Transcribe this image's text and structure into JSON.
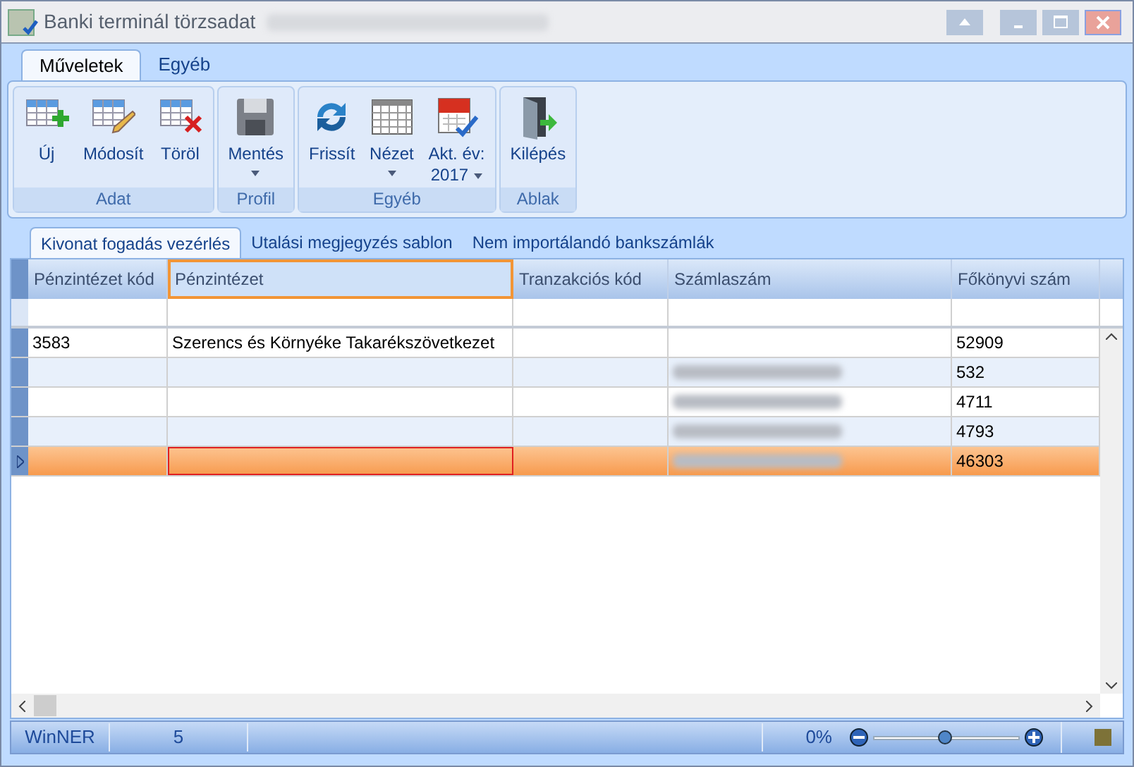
{
  "window": {
    "title": "Banki terminál törzsadat"
  },
  "ribbon_tabs": [
    {
      "label": "Műveletek",
      "selected": true
    },
    {
      "label": "Egyéb",
      "selected": false
    }
  ],
  "ribbon_groups": [
    {
      "label": "Adat",
      "buttons": [
        {
          "kind": "new",
          "label": "Új"
        },
        {
          "kind": "edit",
          "label": "Módosít"
        },
        {
          "kind": "delete",
          "label": "Töröl"
        }
      ]
    },
    {
      "label": "Profil",
      "buttons": [
        {
          "kind": "save",
          "label": "Mentés",
          "dropdown": true
        }
      ]
    },
    {
      "label": "Egyéb",
      "buttons": [
        {
          "kind": "refresh",
          "label": "Frissít"
        },
        {
          "kind": "view",
          "label": "Nézet",
          "dropdown": true
        },
        {
          "kind": "calendar",
          "label": "Akt. év:",
          "sublabel": "2017",
          "dropdown": true
        }
      ]
    },
    {
      "label": "Ablak",
      "buttons": [
        {
          "kind": "exit",
          "label": "Kilépés"
        }
      ]
    }
  ],
  "tabs": [
    {
      "label": "Kivonat fogadás vezérlés",
      "selected": true
    },
    {
      "label": "Utalási megjegyzés sablon",
      "selected": false
    },
    {
      "label": "Nem importálandó bankszámlák",
      "selected": false
    }
  ],
  "table": {
    "columns": [
      {
        "label": "Pénzintézet kód",
        "selected": false
      },
      {
        "label": "Pénzintézet",
        "selected": true
      },
      {
        "label": "Tranzakciós kód",
        "selected": false
      },
      {
        "label": "Számlaszám",
        "selected": false
      },
      {
        "label": "Főkönyvi szám",
        "selected": false
      }
    ],
    "rows": [
      {
        "selected": false,
        "cells": [
          "3583",
          "Szerencs és Környéke Takarékszövetkezet",
          "",
          "",
          "52909"
        ],
        "blurred": false
      },
      {
        "selected": false,
        "cells": [
          "",
          "",
          "",
          "",
          "532"
        ],
        "blurred": true
      },
      {
        "selected": false,
        "cells": [
          "",
          "",
          "",
          "",
          "4711"
        ],
        "blurred": true
      },
      {
        "selected": false,
        "cells": [
          "",
          "",
          "",
          "",
          "4793"
        ],
        "blurred": true
      },
      {
        "selected": true,
        "cells": [
          "",
          "",
          "",
          "",
          "46303"
        ],
        "blurred": true
      }
    ]
  },
  "status_bar": {
    "app": "WinNER",
    "count": "5",
    "zoom": "0%",
    "level": 0.49
  }
}
